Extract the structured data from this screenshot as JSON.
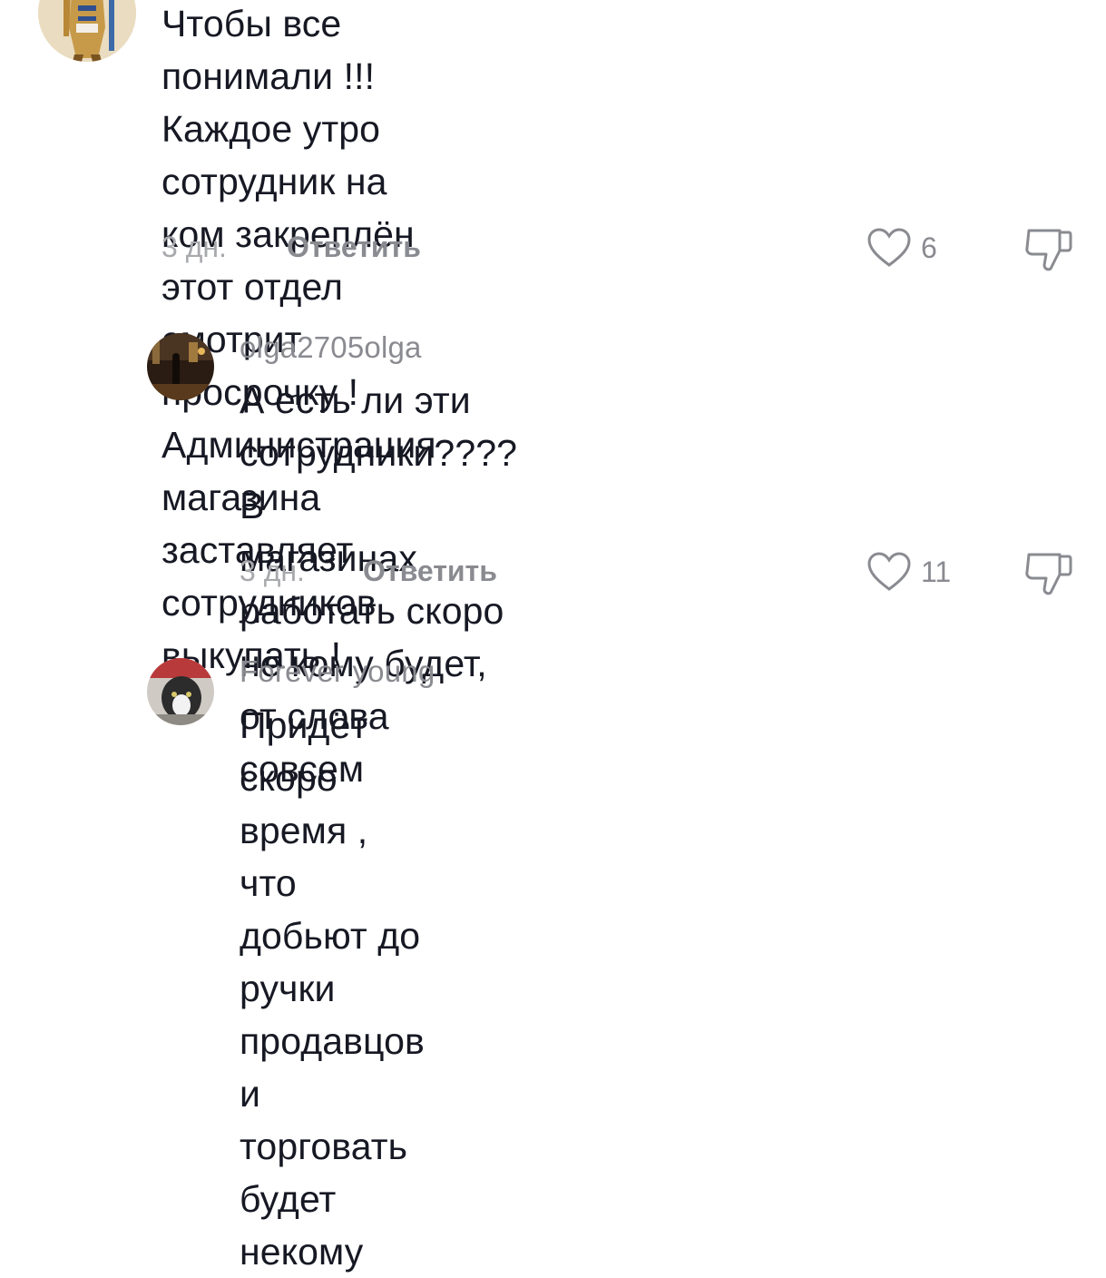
{
  "comments": [
    {
      "avatar_icon": "pharaoh-figure-avatar",
      "text": "Чтобы все понимали !!! Каждое утро\nсотрудник на ком закреплён этот отдел\nсмотрит просрочку ! Администрация\nмагазина заставляет сотрудников выкупать !",
      "time": "3 дн.",
      "reply_label": "Ответить",
      "like_icon": "heart-outline-icon",
      "likes": "6",
      "dislike_icon": "thumbs-down-icon"
    },
    {
      "username": "olga2705olga",
      "avatar_icon": "dark-street-photo-avatar",
      "text": "А есть ли эти сотрудники???? В\nмагазинах работать скоро не кому будет,\nот слова совсем",
      "time": "3 дн.",
      "reply_label": "Ответить",
      "like_icon": "heart-outline-icon",
      "likes": "11",
      "dislike_icon": "thumbs-down-icon"
    },
    {
      "username": "Forever young",
      "avatar_icon": "cat-photo-avatar",
      "text": "Придёт скоро время , что добьют до\nручки продавцов и торговать будет\nнекому"
    }
  ],
  "colors": {
    "text": "#161823",
    "secondary": "#8a8b91",
    "time": "#a8a9ad"
  }
}
